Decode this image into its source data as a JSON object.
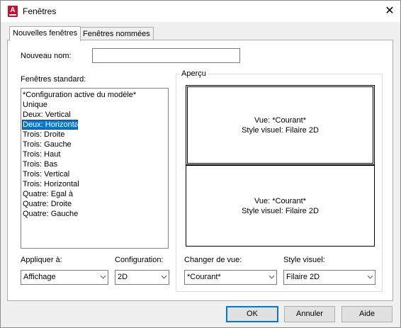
{
  "window": {
    "title": "Fenêtres",
    "app_icon_letter": "A"
  },
  "tabs": [
    {
      "label": "Nouvelles fenêtres",
      "active": true
    },
    {
      "label": "Fenêtres nommées",
      "active": false
    }
  ],
  "new_name": {
    "label": "Nouveau nom:",
    "value": ""
  },
  "standard_viewports": {
    "label": "Fenêtres standard:",
    "items": [
      "*Configuration active du modèle*",
      "Unique",
      "Deux: Vertical",
      "Deux: Horizontal",
      "Trois: Droite",
      "Trois: Gauche",
      "Trois: Haut",
      "Trois: Bas",
      "Trois: Vertical",
      "Trois: Horizontal",
      "Quatre: Egal à",
      "Quatre: Droite",
      "Quatre: Gauche"
    ],
    "selected": "Deux: Horizontal"
  },
  "preview": {
    "label": "Aperçu",
    "top": {
      "view": "Vue: *Courant*",
      "style": "Style visuel: Filaire 2D"
    },
    "bottom": {
      "view": "Vue: *Courant*",
      "style": "Style visuel: Filaire 2D"
    }
  },
  "apply_to": {
    "label": "Appliquer à:",
    "value": "Affichage"
  },
  "setup": {
    "label": "Configuration:",
    "value": "2D"
  },
  "change_view": {
    "label": "Changer de vue:",
    "value": "*Courant*"
  },
  "visual_style": {
    "label": "Style visuel:",
    "value": "Filaire 2D"
  },
  "buttons": {
    "ok": "OK",
    "cancel": "Annuler",
    "help": "Aide"
  },
  "colors": {
    "selection": "#0078d7",
    "default_button_border": "#0078d7",
    "app_icon": "#c8102e"
  }
}
